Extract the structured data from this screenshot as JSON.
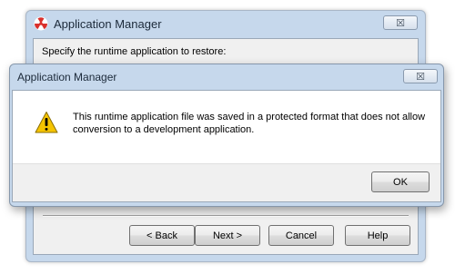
{
  "background_window": {
    "title": "Application Manager",
    "close_label": "☒",
    "prompt": "Specify the runtime application to restore:",
    "buttons": {
      "back": "< Back",
      "next": "Next >",
      "cancel": "Cancel",
      "help": "Help"
    }
  },
  "dialog": {
    "title": "Application Manager",
    "close_label": "☒",
    "message": "This runtime application file was saved in a protected format that does not allow conversion to a development application.",
    "ok_label": "OK"
  },
  "icons": {
    "app_icon": "radiation-icon",
    "dialog_icon": "warning-icon"
  },
  "colors": {
    "window_frame": "#c6d8ec",
    "warning_yellow": "#f5c400",
    "app_icon_red": "#d9302c"
  }
}
